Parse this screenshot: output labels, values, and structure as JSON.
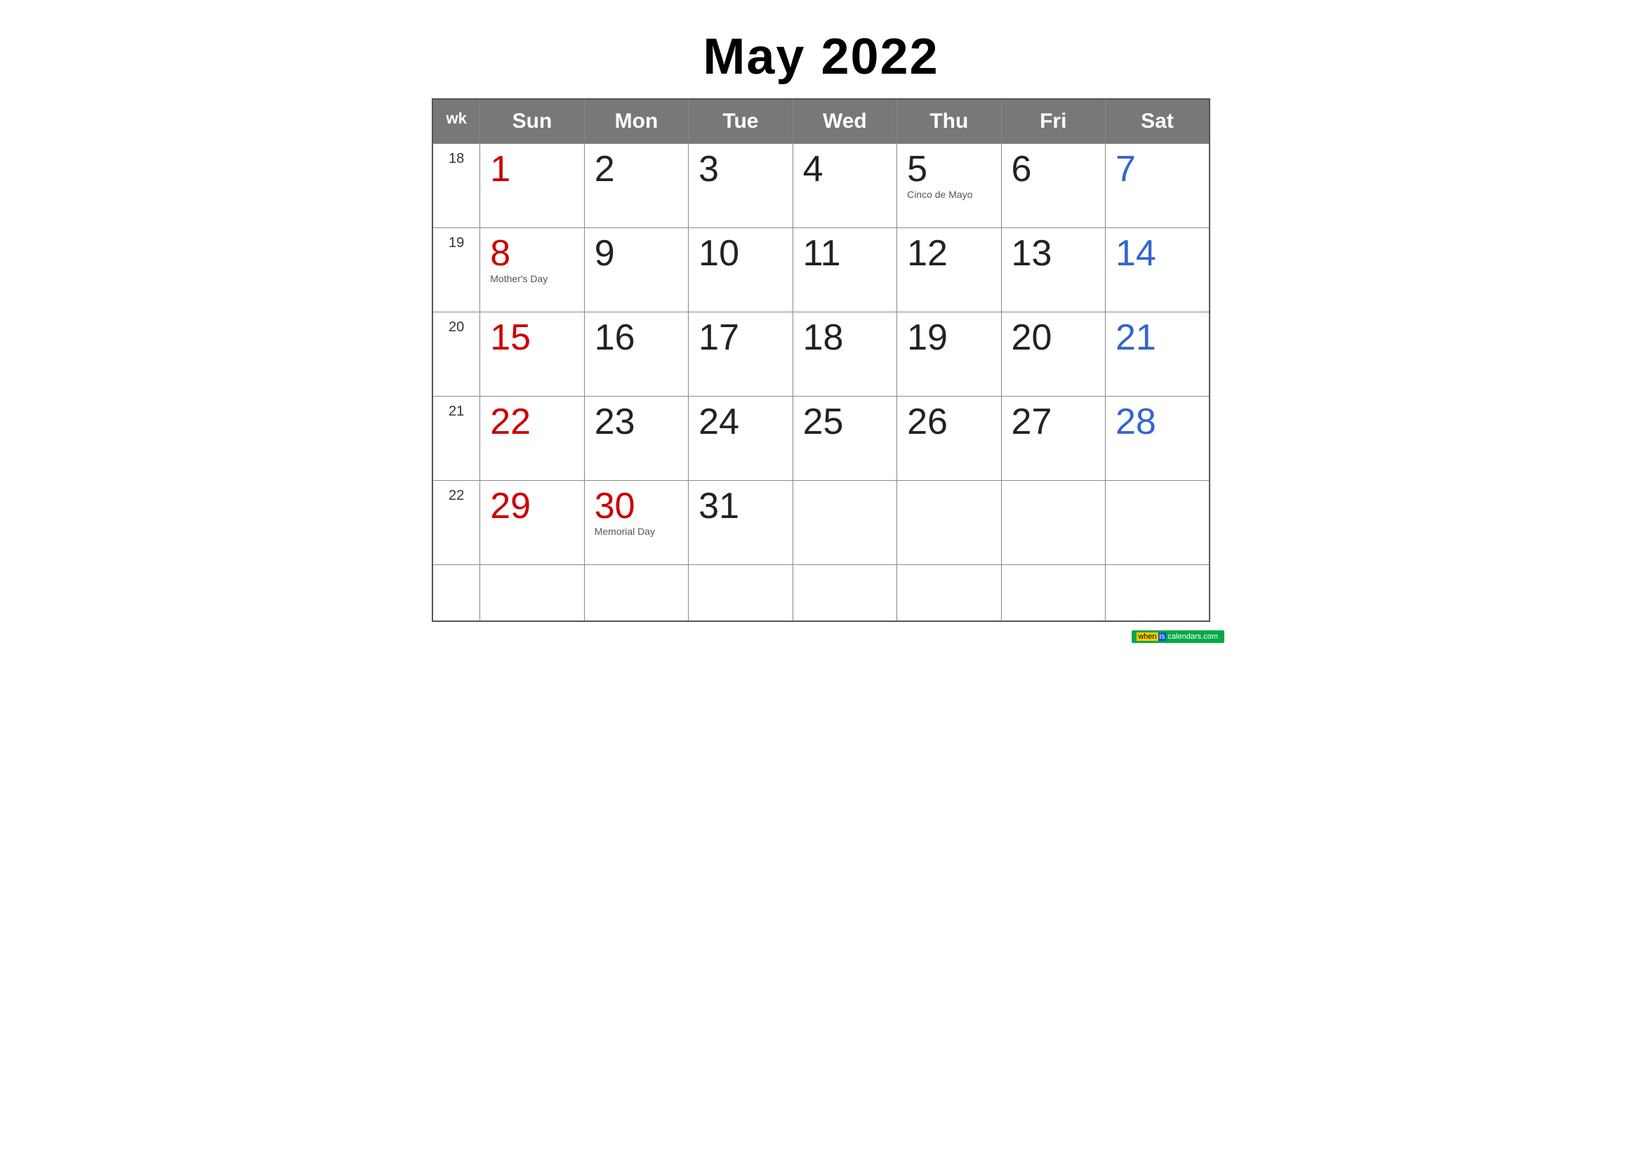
{
  "title": "May 2022",
  "headers": {
    "wk": "wk",
    "days": [
      "Sun",
      "Mon",
      "Tue",
      "Wed",
      "Thu",
      "Fri",
      "Sat"
    ]
  },
  "weeks": [
    {
      "wk": "18",
      "days": [
        {
          "num": "1",
          "type": "sunday",
          "holiday": ""
        },
        {
          "num": "2",
          "type": "weekday",
          "holiday": ""
        },
        {
          "num": "3",
          "type": "weekday",
          "holiday": ""
        },
        {
          "num": "4",
          "type": "weekday",
          "holiday": ""
        },
        {
          "num": "5",
          "type": "weekday",
          "holiday": "Cinco de Mayo"
        },
        {
          "num": "6",
          "type": "weekday",
          "holiday": ""
        },
        {
          "num": "7",
          "type": "saturday",
          "holiday": ""
        }
      ]
    },
    {
      "wk": "19",
      "days": [
        {
          "num": "8",
          "type": "sunday",
          "holiday": "Mother's Day"
        },
        {
          "num": "9",
          "type": "weekday",
          "holiday": ""
        },
        {
          "num": "10",
          "type": "weekday",
          "holiday": ""
        },
        {
          "num": "11",
          "type": "weekday",
          "holiday": ""
        },
        {
          "num": "12",
          "type": "weekday",
          "holiday": ""
        },
        {
          "num": "13",
          "type": "weekday",
          "holiday": ""
        },
        {
          "num": "14",
          "type": "saturday",
          "holiday": ""
        }
      ]
    },
    {
      "wk": "20",
      "days": [
        {
          "num": "15",
          "type": "sunday",
          "holiday": ""
        },
        {
          "num": "16",
          "type": "weekday",
          "holiday": ""
        },
        {
          "num": "17",
          "type": "weekday",
          "holiday": ""
        },
        {
          "num": "18",
          "type": "weekday",
          "holiday": ""
        },
        {
          "num": "19",
          "type": "weekday",
          "holiday": ""
        },
        {
          "num": "20",
          "type": "weekday",
          "holiday": ""
        },
        {
          "num": "21",
          "type": "saturday",
          "holiday": ""
        }
      ]
    },
    {
      "wk": "21",
      "days": [
        {
          "num": "22",
          "type": "sunday",
          "holiday": ""
        },
        {
          "num": "23",
          "type": "weekday",
          "holiday": ""
        },
        {
          "num": "24",
          "type": "weekday",
          "holiday": ""
        },
        {
          "num": "25",
          "type": "weekday",
          "holiday": ""
        },
        {
          "num": "26",
          "type": "weekday",
          "holiday": ""
        },
        {
          "num": "27",
          "type": "weekday",
          "holiday": ""
        },
        {
          "num": "28",
          "type": "saturday",
          "holiday": ""
        }
      ]
    },
    {
      "wk": "22",
      "days": [
        {
          "num": "29",
          "type": "sunday",
          "holiday": ""
        },
        {
          "num": "30",
          "type": "holiday-red",
          "holiday": "Memorial Day"
        },
        {
          "num": "31",
          "type": "weekday",
          "holiday": ""
        },
        {
          "num": "",
          "type": "empty",
          "holiday": ""
        },
        {
          "num": "",
          "type": "empty",
          "holiday": ""
        },
        {
          "num": "",
          "type": "empty",
          "holiday": ""
        },
        {
          "num": "",
          "type": "empty",
          "holiday": ""
        }
      ]
    }
  ],
  "watermark": "wheniscalendars.com",
  "colors": {
    "header_bg": "#787878",
    "sunday": "#cc0000",
    "saturday": "#3366cc",
    "holiday_red": "#cc0000",
    "weekday": "#222222"
  }
}
